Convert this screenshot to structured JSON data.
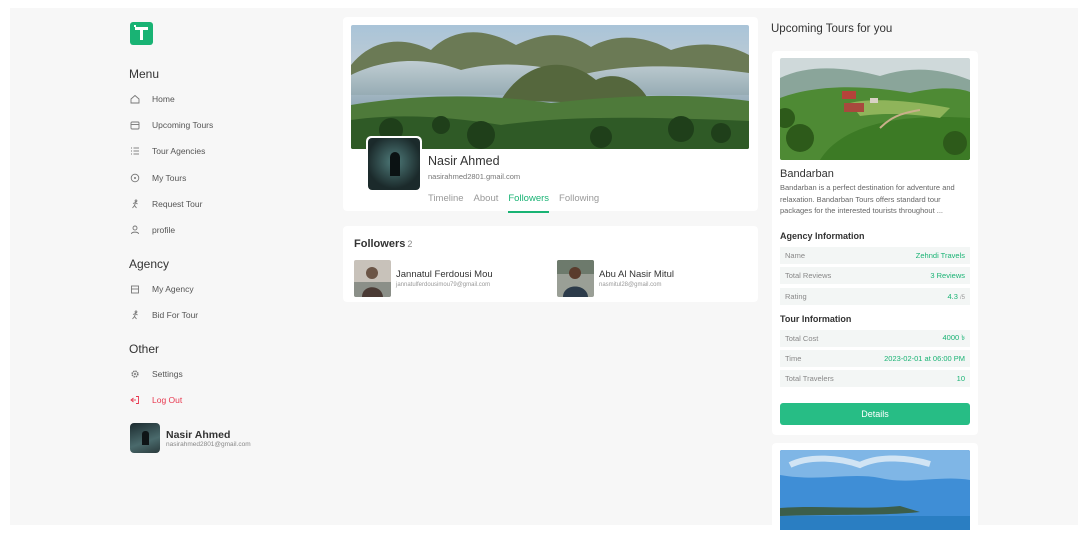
{
  "sidebar": {
    "menu_title": "Menu",
    "menu_items": [
      {
        "label": "Home",
        "icon": "home-icon"
      },
      {
        "label": "Upcoming Tours",
        "icon": "calendar-icon"
      },
      {
        "label": "Tour Agencies",
        "icon": "list-icon"
      },
      {
        "label": "My Tours",
        "icon": "circle-icon"
      },
      {
        "label": "Request Tour",
        "icon": "walk-icon"
      },
      {
        "label": "profile",
        "icon": "user-icon"
      }
    ],
    "agency_title": "Agency",
    "agency_items": [
      {
        "label": "My Agency",
        "icon": "building-icon"
      },
      {
        "label": "Bid For Tour",
        "icon": "walk-icon"
      }
    ],
    "other_title": "Other",
    "other_items": [
      {
        "label": "Settings",
        "icon": "gear-icon"
      },
      {
        "label": "Log Out",
        "icon": "logout-icon"
      }
    ],
    "user": {
      "name": "Nasir Ahmed",
      "email": "nasirahmed2801@gmail.com"
    }
  },
  "profile": {
    "name": "Nasir Ahmed",
    "email": "nasirahmed2801.gmail.com",
    "tabs": [
      "Timeline",
      "About",
      "Followers",
      "Following"
    ],
    "active_tab": "Followers"
  },
  "followers": {
    "title": "Followers",
    "count": "2",
    "items": [
      {
        "name": "Jannatul Ferdousi Mou",
        "email": "jannatulferdousimou79@gmail.com"
      },
      {
        "name": "Abu Al Nasir Mitul",
        "email": "nasmitul28@gmail.com"
      }
    ]
  },
  "upcoming": {
    "title": "Upcoming Tours for you",
    "tour": {
      "name": "Bandarban",
      "description": "Bandarban is a perfect destination for adventure and relaxation. Bandarban Tours offers standard tour packages for the interested tourists throughout ...",
      "agency_title": "Agency Information",
      "agency_rows": [
        {
          "k": "Name",
          "v": "Zehndi Travels",
          "unit": ""
        },
        {
          "k": "Total Reviews",
          "v": "3 Reviews",
          "unit": ""
        },
        {
          "k": "Rating",
          "v": "4.3",
          "unit": "/5"
        }
      ],
      "tour_title": "Tour Information",
      "tour_rows": [
        {
          "k": "Total Cost",
          "v": "4000 ৳",
          "unit": ""
        },
        {
          "k": "Time",
          "v": "2023-02-01 at 06:00 PM",
          "unit": ""
        },
        {
          "k": "Total Travelers",
          "v": "10",
          "unit": ""
        }
      ],
      "button": "Details"
    }
  },
  "colors": {
    "accent": "#19b374",
    "danger": "#e8384f"
  }
}
